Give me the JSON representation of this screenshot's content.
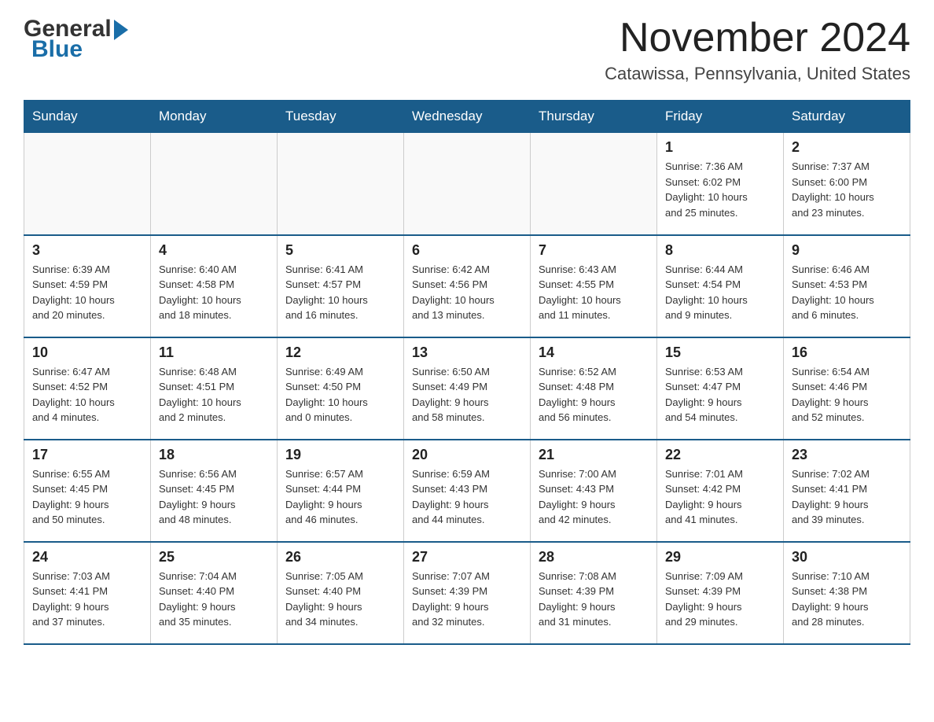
{
  "header": {
    "logo_general": "General",
    "logo_blue": "Blue",
    "month_title": "November 2024",
    "location": "Catawissa, Pennsylvania, United States"
  },
  "days_of_week": [
    "Sunday",
    "Monday",
    "Tuesday",
    "Wednesday",
    "Thursday",
    "Friday",
    "Saturday"
  ],
  "weeks": [
    [
      {
        "day": "",
        "info": ""
      },
      {
        "day": "",
        "info": ""
      },
      {
        "day": "",
        "info": ""
      },
      {
        "day": "",
        "info": ""
      },
      {
        "day": "",
        "info": ""
      },
      {
        "day": "1",
        "info": "Sunrise: 7:36 AM\nSunset: 6:02 PM\nDaylight: 10 hours\nand 25 minutes."
      },
      {
        "day": "2",
        "info": "Sunrise: 7:37 AM\nSunset: 6:00 PM\nDaylight: 10 hours\nand 23 minutes."
      }
    ],
    [
      {
        "day": "3",
        "info": "Sunrise: 6:39 AM\nSunset: 4:59 PM\nDaylight: 10 hours\nand 20 minutes."
      },
      {
        "day": "4",
        "info": "Sunrise: 6:40 AM\nSunset: 4:58 PM\nDaylight: 10 hours\nand 18 minutes."
      },
      {
        "day": "5",
        "info": "Sunrise: 6:41 AM\nSunset: 4:57 PM\nDaylight: 10 hours\nand 16 minutes."
      },
      {
        "day": "6",
        "info": "Sunrise: 6:42 AM\nSunset: 4:56 PM\nDaylight: 10 hours\nand 13 minutes."
      },
      {
        "day": "7",
        "info": "Sunrise: 6:43 AM\nSunset: 4:55 PM\nDaylight: 10 hours\nand 11 minutes."
      },
      {
        "day": "8",
        "info": "Sunrise: 6:44 AM\nSunset: 4:54 PM\nDaylight: 10 hours\nand 9 minutes."
      },
      {
        "day": "9",
        "info": "Sunrise: 6:46 AM\nSunset: 4:53 PM\nDaylight: 10 hours\nand 6 minutes."
      }
    ],
    [
      {
        "day": "10",
        "info": "Sunrise: 6:47 AM\nSunset: 4:52 PM\nDaylight: 10 hours\nand 4 minutes."
      },
      {
        "day": "11",
        "info": "Sunrise: 6:48 AM\nSunset: 4:51 PM\nDaylight: 10 hours\nand 2 minutes."
      },
      {
        "day": "12",
        "info": "Sunrise: 6:49 AM\nSunset: 4:50 PM\nDaylight: 10 hours\nand 0 minutes."
      },
      {
        "day": "13",
        "info": "Sunrise: 6:50 AM\nSunset: 4:49 PM\nDaylight: 9 hours\nand 58 minutes."
      },
      {
        "day": "14",
        "info": "Sunrise: 6:52 AM\nSunset: 4:48 PM\nDaylight: 9 hours\nand 56 minutes."
      },
      {
        "day": "15",
        "info": "Sunrise: 6:53 AM\nSunset: 4:47 PM\nDaylight: 9 hours\nand 54 minutes."
      },
      {
        "day": "16",
        "info": "Sunrise: 6:54 AM\nSunset: 4:46 PM\nDaylight: 9 hours\nand 52 minutes."
      }
    ],
    [
      {
        "day": "17",
        "info": "Sunrise: 6:55 AM\nSunset: 4:45 PM\nDaylight: 9 hours\nand 50 minutes."
      },
      {
        "day": "18",
        "info": "Sunrise: 6:56 AM\nSunset: 4:45 PM\nDaylight: 9 hours\nand 48 minutes."
      },
      {
        "day": "19",
        "info": "Sunrise: 6:57 AM\nSunset: 4:44 PM\nDaylight: 9 hours\nand 46 minutes."
      },
      {
        "day": "20",
        "info": "Sunrise: 6:59 AM\nSunset: 4:43 PM\nDaylight: 9 hours\nand 44 minutes."
      },
      {
        "day": "21",
        "info": "Sunrise: 7:00 AM\nSunset: 4:43 PM\nDaylight: 9 hours\nand 42 minutes."
      },
      {
        "day": "22",
        "info": "Sunrise: 7:01 AM\nSunset: 4:42 PM\nDaylight: 9 hours\nand 41 minutes."
      },
      {
        "day": "23",
        "info": "Sunrise: 7:02 AM\nSunset: 4:41 PM\nDaylight: 9 hours\nand 39 minutes."
      }
    ],
    [
      {
        "day": "24",
        "info": "Sunrise: 7:03 AM\nSunset: 4:41 PM\nDaylight: 9 hours\nand 37 minutes."
      },
      {
        "day": "25",
        "info": "Sunrise: 7:04 AM\nSunset: 4:40 PM\nDaylight: 9 hours\nand 35 minutes."
      },
      {
        "day": "26",
        "info": "Sunrise: 7:05 AM\nSunset: 4:40 PM\nDaylight: 9 hours\nand 34 minutes."
      },
      {
        "day": "27",
        "info": "Sunrise: 7:07 AM\nSunset: 4:39 PM\nDaylight: 9 hours\nand 32 minutes."
      },
      {
        "day": "28",
        "info": "Sunrise: 7:08 AM\nSunset: 4:39 PM\nDaylight: 9 hours\nand 31 minutes."
      },
      {
        "day": "29",
        "info": "Sunrise: 7:09 AM\nSunset: 4:39 PM\nDaylight: 9 hours\nand 29 minutes."
      },
      {
        "day": "30",
        "info": "Sunrise: 7:10 AM\nSunset: 4:38 PM\nDaylight: 9 hours\nand 28 minutes."
      }
    ]
  ]
}
